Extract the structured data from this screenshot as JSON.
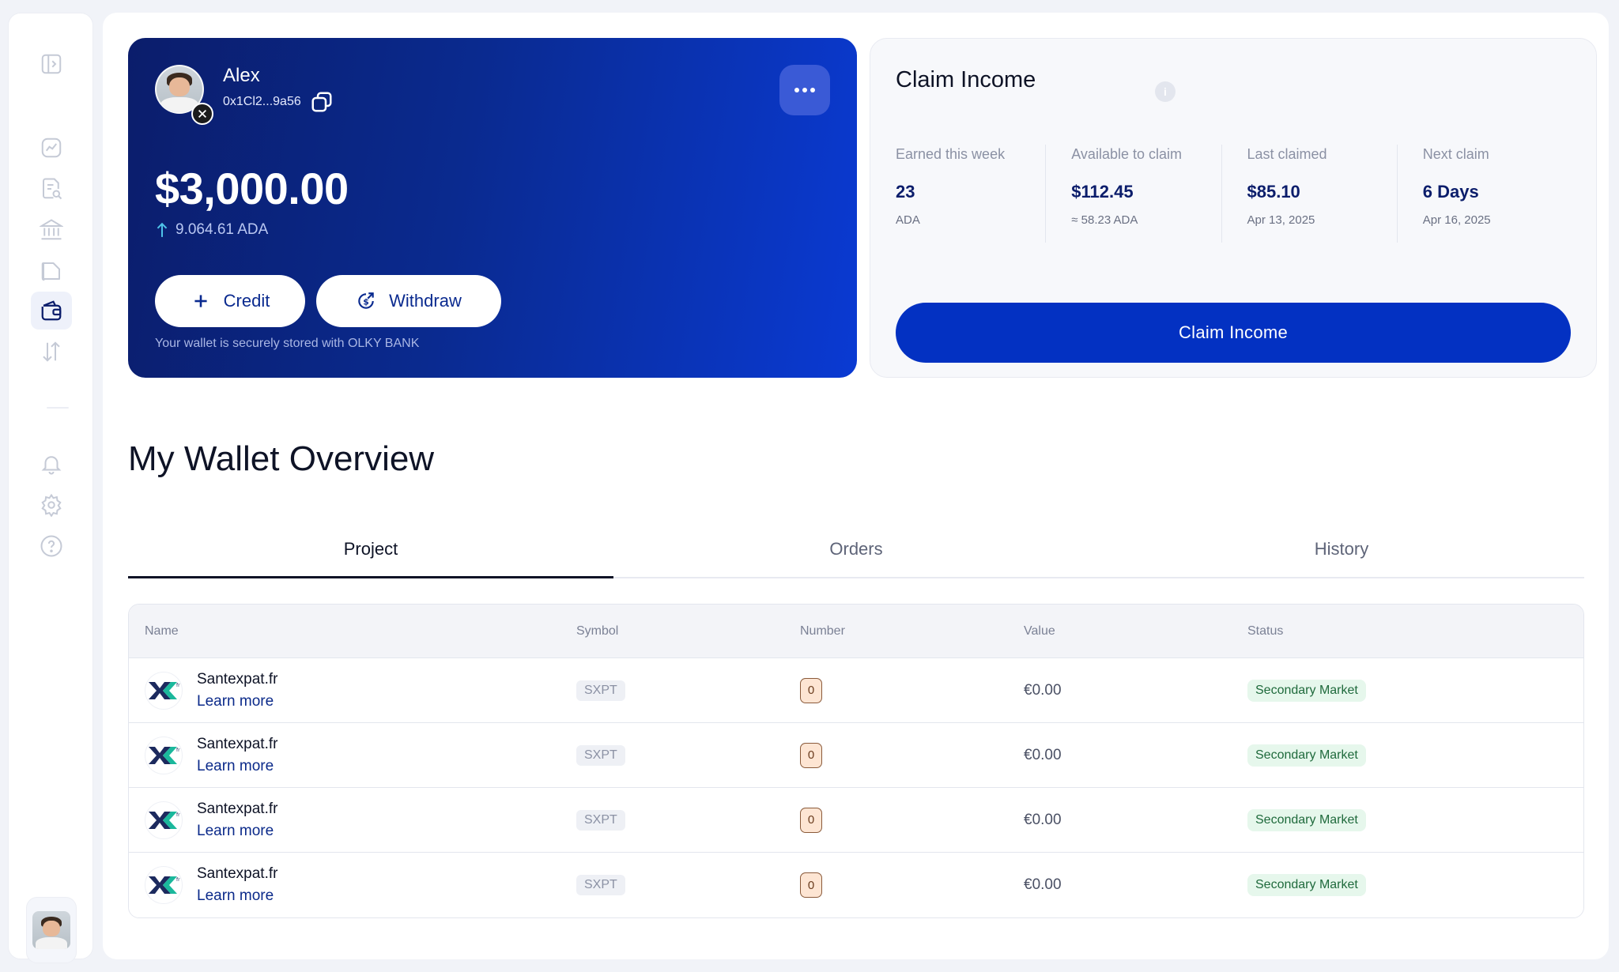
{
  "sidebar": {
    "icons": [
      "panel-toggle-icon",
      "chart-line-icon",
      "document-search-icon",
      "bank-icon",
      "folder-icon",
      "wallet-icon",
      "transfer-arrows-icon",
      "bell-icon",
      "gear-icon",
      "help-icon"
    ],
    "active": "wallet-icon"
  },
  "wallet": {
    "user_name": "Alex",
    "address": "0x1Cl2...9a56",
    "balance": "$3,000.00",
    "ada": "9.064.61 ADA",
    "credit_label": "Credit",
    "withdraw_label": "Withdraw",
    "footnote": "Your wallet is securely stored with OLKY BANK",
    "gradient": [
      "#0b1d6b",
      "#0a3ad3"
    ]
  },
  "claim": {
    "title": "Claim Income",
    "stats": [
      {
        "label": "Earned this week",
        "value": "23",
        "sub": "ADA"
      },
      {
        "label": "Available to claim",
        "value": "$112.45",
        "sub": "≈ 58.23 ADA"
      },
      {
        "label": "Last claimed",
        "value": "$85.10",
        "sub": "Apr 13, 2025"
      },
      {
        "label": "Next claim",
        "value": "6 Days",
        "sub": "Apr 16, 2025"
      }
    ],
    "button_label": "Claim Income",
    "accent": "#0331c2"
  },
  "overview": {
    "title": "My Wallet Overview",
    "tabs": [
      {
        "label": "Project",
        "active": true
      },
      {
        "label": "Orders",
        "active": false
      },
      {
        "label": "History",
        "active": false
      }
    ],
    "columns": [
      "Name",
      "Symbol",
      "Number",
      "Value",
      "Status"
    ],
    "rows": [
      {
        "name": "Santexpat.fr",
        "link": "Learn more",
        "symbol": "SXPT",
        "number": "0",
        "value": "€0.00",
        "status": "Secondary Market"
      },
      {
        "name": "Santexpat.fr",
        "link": "Learn more",
        "symbol": "SXPT",
        "number": "0",
        "value": "€0.00",
        "status": "Secondary Market"
      },
      {
        "name": "Santexpat.fr",
        "link": "Learn more",
        "symbol": "SXPT",
        "number": "0",
        "value": "€0.00",
        "status": "Secondary Market"
      },
      {
        "name": "Santexpat.fr",
        "link": "Learn more",
        "symbol": "SXPT",
        "number": "0",
        "value": "€0.00",
        "status": "Secondary Market"
      }
    ]
  }
}
